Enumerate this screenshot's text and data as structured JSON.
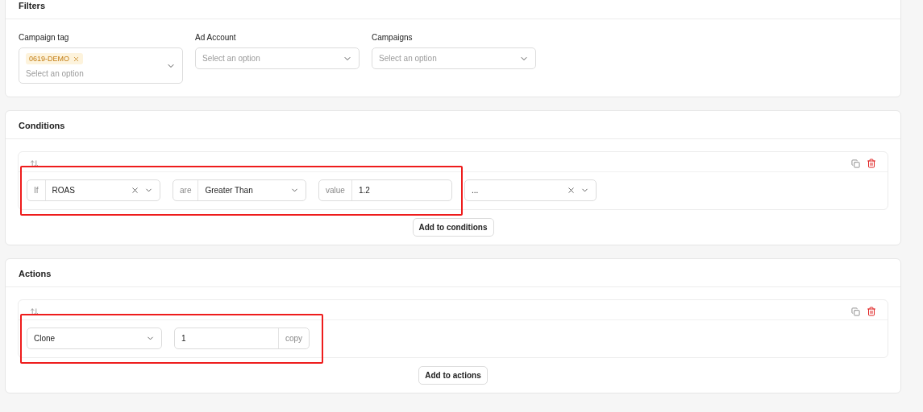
{
  "filters": {
    "title": "Filters",
    "fields": [
      {
        "label": "Campaign tag",
        "tags": [
          "0619-DEMO"
        ],
        "placeholder": "Select an option"
      },
      {
        "label": "Ad Account",
        "placeholder": "Select an option"
      },
      {
        "label": "Campaigns",
        "placeholder": "Select an option"
      }
    ]
  },
  "conditions": {
    "title": "Conditions",
    "rules": [
      {
        "highlighted": true,
        "parts": [
          {
            "kind": "select",
            "prefix": "If",
            "value": "ROAS",
            "clearable": true
          },
          {
            "kind": "select",
            "prefix": "are",
            "value": "Greater Than",
            "clearable": false
          },
          {
            "kind": "input",
            "prefix": "value",
            "value": "1.2"
          },
          {
            "kind": "select",
            "value": "...",
            "clearable": true
          }
        ]
      }
    ],
    "add_button": "Add to conditions"
  },
  "actions": {
    "title": "Actions",
    "rules": [
      {
        "highlighted": true,
        "parts": [
          {
            "kind": "select",
            "value": "Clone",
            "clearable": false
          },
          {
            "kind": "input",
            "value": "1",
            "suffix": "copy"
          }
        ]
      }
    ],
    "add_button": "Add to actions"
  }
}
